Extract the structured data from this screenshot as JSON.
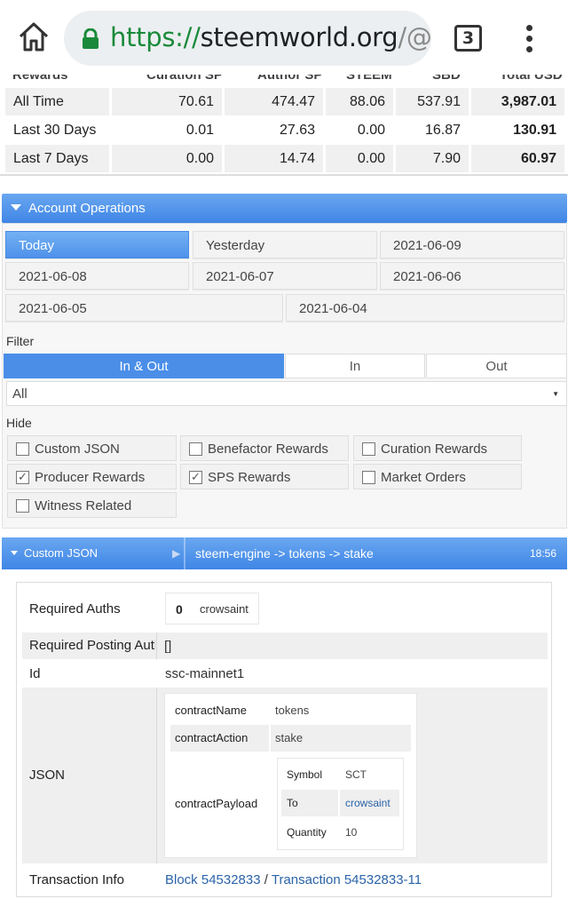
{
  "browser": {
    "url_scheme": "https://",
    "url_host": "steemworld.org",
    "url_path": "/@crows",
    "tab_count": "3"
  },
  "rewards": {
    "headers": [
      "Rewards",
      "Curation SP",
      "Author SP",
      "STEEM",
      "SBD",
      "Total USD"
    ],
    "rows": [
      {
        "label": "All Time",
        "curation_sp": "70.61",
        "author_sp": "474.47",
        "steem": "88.06",
        "sbd": "537.91",
        "total_usd": "3,987.01"
      },
      {
        "label": "Last 30 Days",
        "curation_sp": "0.01",
        "author_sp": "27.63",
        "steem": "0.00",
        "sbd": "16.87",
        "total_usd": "130.91"
      },
      {
        "label": "Last 7 Days",
        "curation_sp": "0.00",
        "author_sp": "14.74",
        "steem": "0.00",
        "sbd": "7.90",
        "total_usd": "60.97"
      }
    ]
  },
  "account_operations": {
    "title": "Account Operations",
    "dates": [
      "Today",
      "Yesterday",
      "2021-06-09",
      "2021-06-08",
      "2021-06-07",
      "2021-06-06",
      "2021-06-05",
      "2021-06-04"
    ],
    "filter_label": "Filter",
    "filter_tabs": [
      "In & Out",
      "In",
      "Out"
    ],
    "filter_select": "All",
    "hide_label": "Hide",
    "hide_options": [
      {
        "label": "Custom JSON",
        "checked": false
      },
      {
        "label": "Benefactor Rewards",
        "checked": false
      },
      {
        "label": "Curation Rewards",
        "checked": false
      },
      {
        "label": "Producer Rewards",
        "checked": true
      },
      {
        "label": "SPS Rewards",
        "checked": true
      },
      {
        "label": "Market Orders",
        "checked": false
      },
      {
        "label": "Witness Related",
        "checked": false
      }
    ]
  },
  "operation": {
    "type": "Custom JSON",
    "summary": "steem-engine -> tokens -> stake",
    "time": "18:56",
    "required_auths_label": "Required Auths",
    "required_auths_index": "0",
    "required_auths_value": "crowsaint",
    "required_posting_label": "Required Posting Auth",
    "required_posting_value": "[]",
    "id_label": "Id",
    "id_value": "ssc-mainnet1",
    "json_label": "JSON",
    "contract_name_label": "contractName",
    "contract_name_value": "tokens",
    "contract_action_label": "contractAction",
    "contract_action_value": "stake",
    "contract_payload_label": "contractPayload",
    "payload": {
      "symbol_label": "Symbol",
      "symbol_value": "SCT",
      "to_label": "To",
      "to_value": "crowsaint",
      "quantity_label": "Quantity",
      "quantity_value": "10"
    },
    "tx_info_label": "Transaction Info",
    "block_link": "Block 54532833",
    "separator": "/",
    "tx_link": "Transaction 54532833-11"
  }
}
